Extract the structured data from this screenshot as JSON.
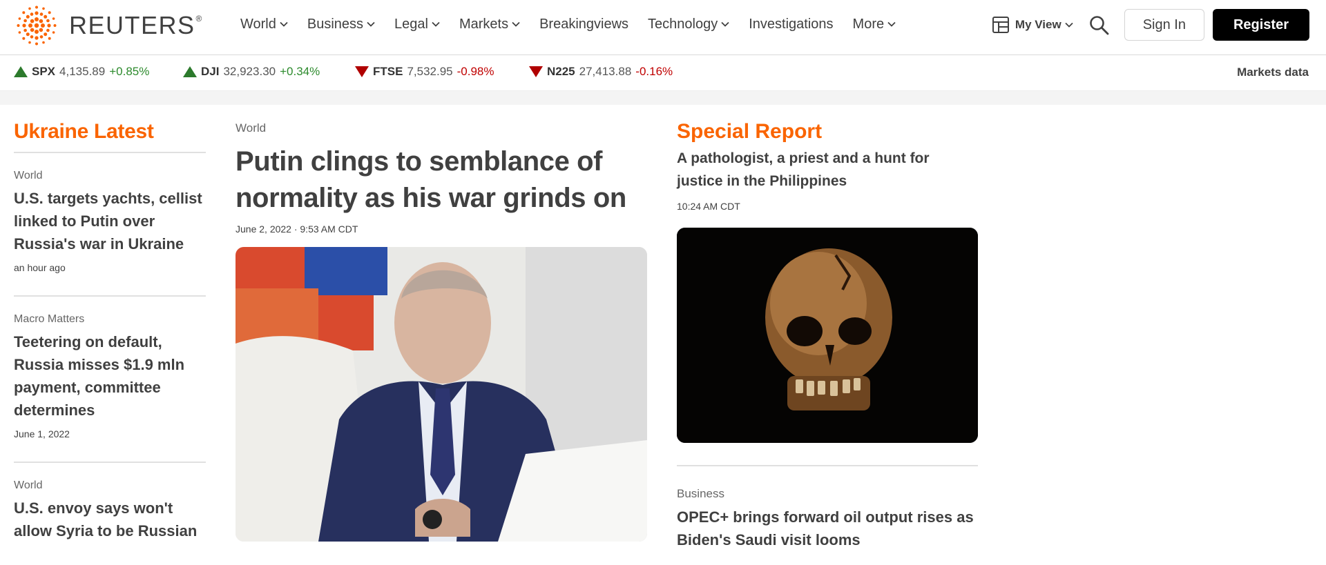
{
  "header": {
    "logo_text": "REUTERS",
    "logo_mark": "®",
    "nav": [
      {
        "label": "World",
        "has_dropdown": true
      },
      {
        "label": "Business",
        "has_dropdown": true
      },
      {
        "label": "Legal",
        "has_dropdown": true
      },
      {
        "label": "Markets",
        "has_dropdown": true
      },
      {
        "label": "Breakingviews",
        "has_dropdown": false
      },
      {
        "label": "Technology",
        "has_dropdown": true
      },
      {
        "label": "Investigations",
        "has_dropdown": false
      },
      {
        "label": "More",
        "has_dropdown": true
      }
    ],
    "my_view_label": "My View",
    "sign_in_label": "Sign In",
    "register_label": "Register"
  },
  "ticker": {
    "items": [
      {
        "symbol": "SPX",
        "value": "4,135.89",
        "change": "+0.85%",
        "direction": "up"
      },
      {
        "symbol": "DJI",
        "value": "32,923.30",
        "change": "+0.34%",
        "direction": "up"
      },
      {
        "symbol": "FTSE",
        "value": "7,532.95",
        "change": "-0.98%",
        "direction": "down"
      },
      {
        "symbol": "N225",
        "value": "27,413.88",
        "change": "-0.16%",
        "direction": "down"
      }
    ],
    "markets_data_label": "Markets data"
  },
  "left": {
    "section_title": "Ukraine Latest",
    "stories": [
      {
        "kicker": "World",
        "headline": "U.S. targets yachts, cellist linked to Putin over Russia's war in Ukraine",
        "time": "an hour ago"
      },
      {
        "kicker": "Macro Matters",
        "headline": "Teetering on default, Russia misses $1.9 mln payment, committee determines",
        "time": "June 1, 2022"
      },
      {
        "kicker": "World",
        "headline": "U.S. envoy says won't allow Syria to be Russian",
        "time": ""
      }
    ]
  },
  "center": {
    "kicker": "World",
    "headline": "Putin clings to semblance of normality as his war grinds on",
    "time": "June 2, 2022 · 9:53 AM CDT"
  },
  "right": {
    "section_title": "Special Report",
    "headline": "A pathologist, a priest and a hunt for justice in the Philippines",
    "time": "10:24 AM CDT",
    "story2": {
      "kicker": "Business",
      "headline": "OPEC+ brings forward oil output rises as Biden's Saudi visit looms"
    }
  },
  "colors": {
    "accent": "#fa6400",
    "up": "#2c8a2c",
    "down": "#c00000"
  }
}
